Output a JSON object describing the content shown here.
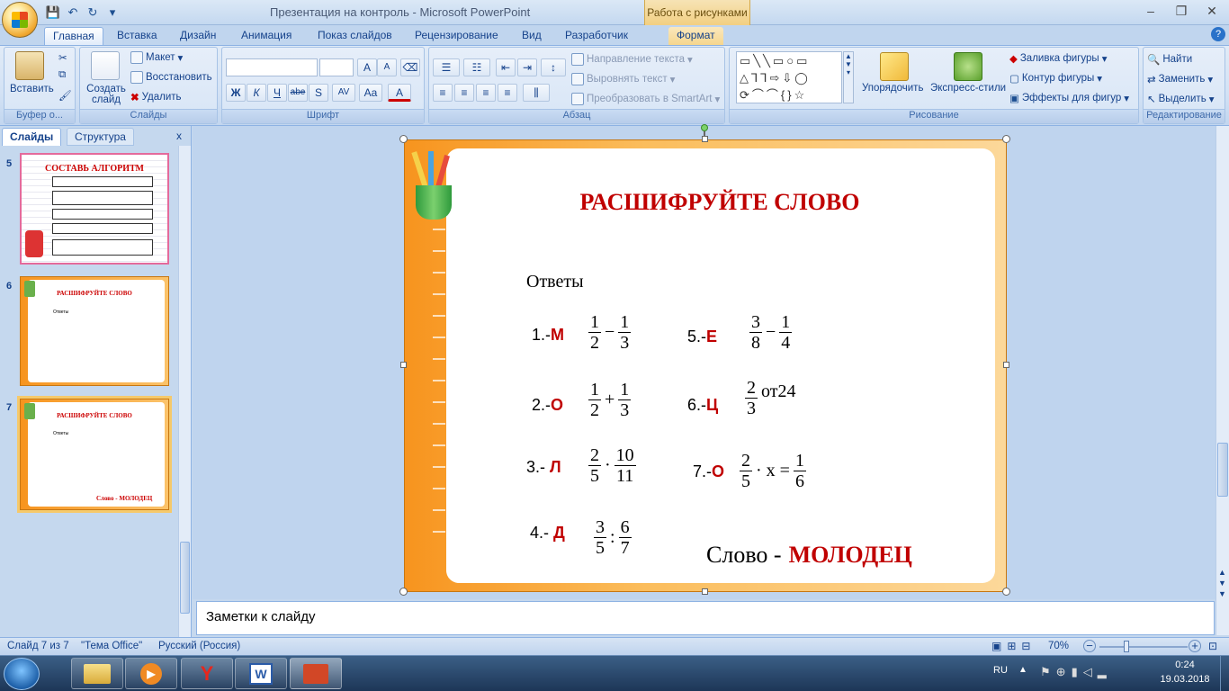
{
  "window": {
    "title": "Презентация на контроль - Microsoft PowerPoint",
    "context_tab_title": "Работа с рисунками",
    "controls": {
      "minimize": "–",
      "restore": "❐",
      "close": "✕"
    }
  },
  "quick_access": {
    "save": "💾",
    "undo": "↶",
    "redo": "↻",
    "more": "▾"
  },
  "tabs": [
    {
      "label": "Главная"
    },
    {
      "label": "Вставка"
    },
    {
      "label": "Дизайн"
    },
    {
      "label": "Анимация"
    },
    {
      "label": "Показ слайдов"
    },
    {
      "label": "Рецензирование"
    },
    {
      "label": "Вид"
    },
    {
      "label": "Разработчик"
    },
    {
      "label": "Формат"
    }
  ],
  "ribbon": {
    "clipboard": {
      "label": "Буфер о...",
      "paste": "Вставить"
    },
    "slides": {
      "label": "Слайды",
      "new_slide": "Создать слайд",
      "layout": "Макет",
      "reset": "Восстановить",
      "delete": "Удалить"
    },
    "font": {
      "label": "Шрифт",
      "bold": "Ж",
      "italic": "К",
      "underline": "Ч",
      "strike": "abe",
      "shadow": "S",
      "spacing": "AV",
      "case": "Aa",
      "color": "A",
      "grow": "A",
      "shrink": "A"
    },
    "paragraph": {
      "label": "Абзац",
      "text_direction": "Направление текста",
      "align_text": "Выровнять текст",
      "smartart": "Преобразовать в SmartArt"
    },
    "drawing": {
      "label": "Рисование",
      "arrange": "Упорядочить",
      "quick_styles": "Экспресс-стили",
      "fill": "Заливка фигуры",
      "outline": "Контур фигуры",
      "effects": "Эффекты для фигур"
    },
    "editing": {
      "label": "Редактирование",
      "find": "Найти",
      "replace": "Заменить",
      "select": "Выделить"
    }
  },
  "pane": {
    "tab_slides": "Слайды",
    "tab_outline": "Структура",
    "close": "x",
    "thumbnails": [
      {
        "num": "5",
        "title": "СОСТАВЬ  АЛГОРИТМ"
      },
      {
        "num": "6",
        "title": "РАСШИФРУЙТЕ СЛОВО",
        "answers": "Ответы"
      },
      {
        "num": "7",
        "title": "РАСШИФРУЙТЕ СЛОВО",
        "answers": "Ответы",
        "word": "Слово - МОЛОДЕЦ"
      }
    ]
  },
  "slide": {
    "title": "РАСШИФРУЙТЕ СЛОВО",
    "answers_label": "Ответы",
    "items": [
      {
        "num": "1.-",
        "letter": "М",
        "a_n": "1",
        "a_d": "2",
        "op": "−",
        "b_n": "1",
        "b_d": "3"
      },
      {
        "num": "2.-",
        "letter": "О",
        "a_n": "1",
        "a_d": "2",
        "op": "+",
        "b_n": "1",
        "b_d": "3"
      },
      {
        "num": "3.- ",
        "letter": "Л",
        "a_n": "2",
        "a_d": "5",
        "op": "·",
        "b_n": "10",
        "b_d": "11"
      },
      {
        "num": "4.- ",
        "letter": "Д",
        "a_n": "3",
        "a_d": "5",
        "op": ":",
        "b_n": "6",
        "b_d": "7"
      },
      {
        "num": "5.-",
        "letter": "Е",
        "a_n": "3",
        "a_d": "8",
        "op": "−",
        "b_n": "1",
        "b_d": "4"
      },
      {
        "num": "6.-",
        "letter": "Ц",
        "a_n": "2",
        "a_d": "3",
        "tail": "от24"
      },
      {
        "num": "7.-",
        "letter": "О",
        "a_n": "2",
        "a_d": "5",
        "mid": "· x =",
        "b_n": "1",
        "b_d": "6"
      }
    ],
    "word_label": "Слово -",
    "word_value": "МОЛОДЕЦ"
  },
  "notes": {
    "placeholder": "Заметки к слайду"
  },
  "status": {
    "slide_counter": "Слайд 7 из 7",
    "theme": "\"Тема Office\"",
    "language": "Русский (Россия)",
    "zoom": "70%"
  },
  "taskbar": {
    "lang": "RU",
    "time": "0:24",
    "date": "19.03.2018"
  }
}
